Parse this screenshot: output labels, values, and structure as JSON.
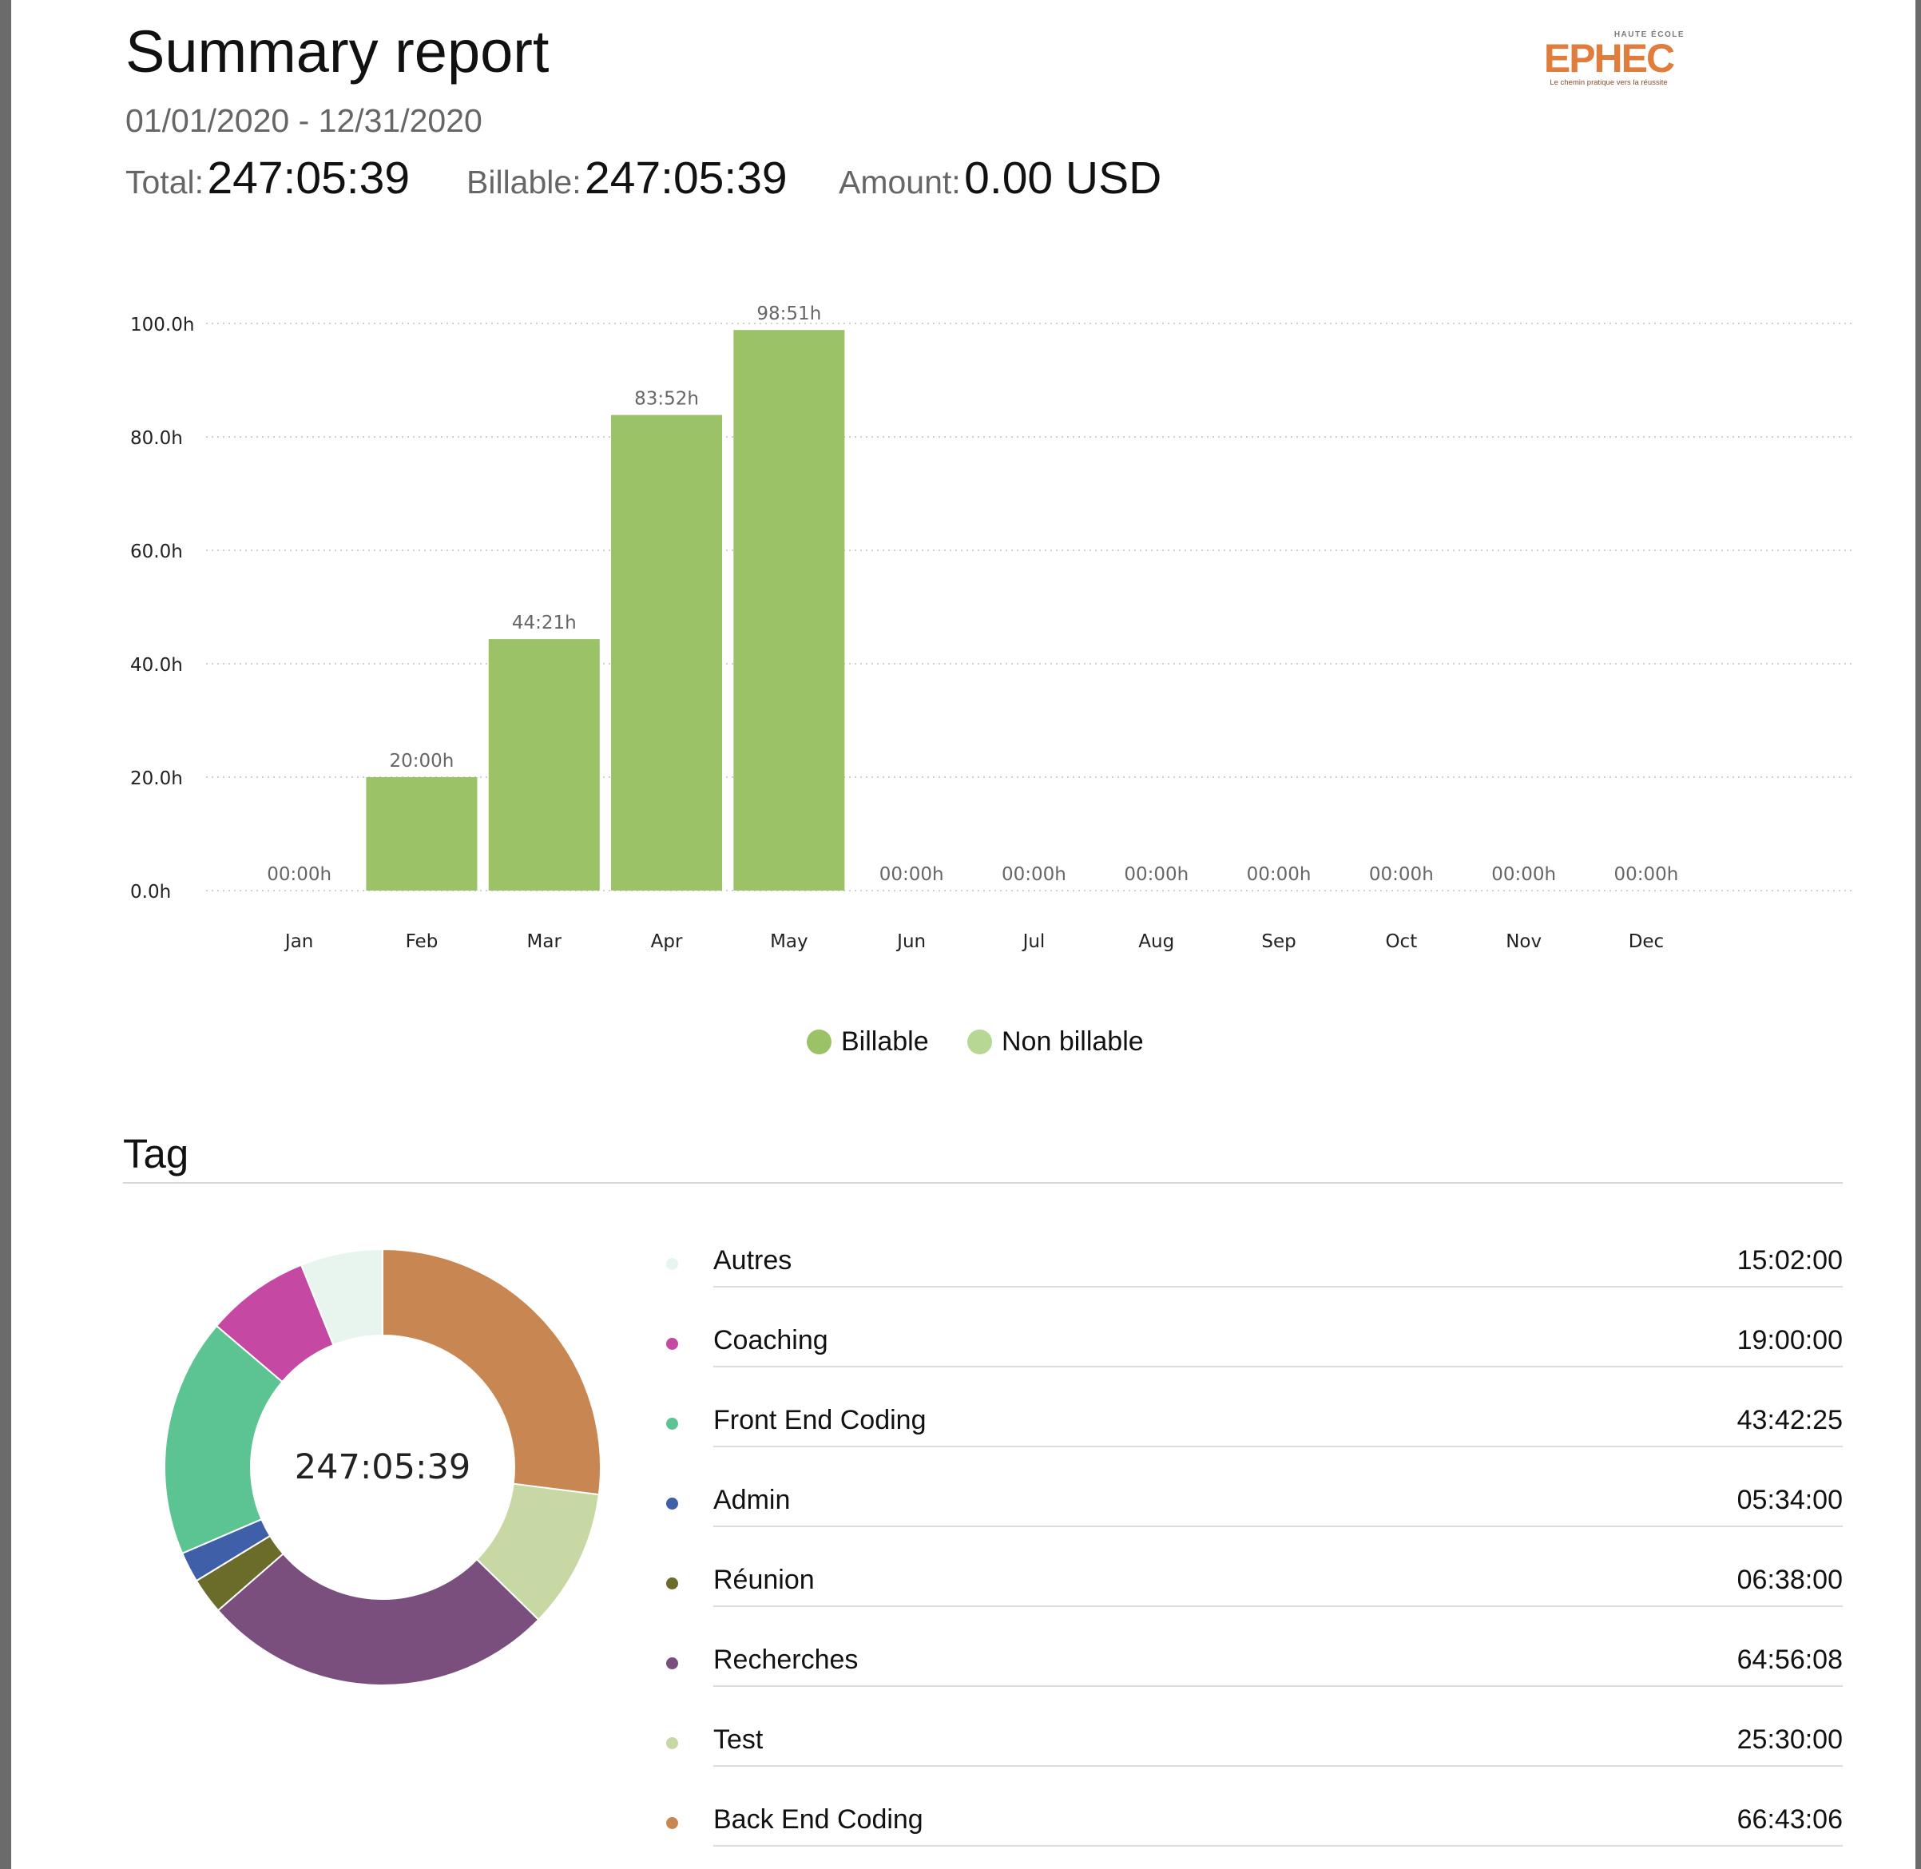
{
  "header": {
    "title": "Summary report",
    "date_range": "01/01/2020 - 12/31/2020",
    "total_label": "Total:",
    "total_value": "247:05:39",
    "billable_label": "Billable:",
    "billable_value": "247:05:39",
    "amount_label": "Amount:",
    "amount_value": "0.00 USD"
  },
  "logo": {
    "top_text": "HAUTE ÉCOLE",
    "name": "EPHEC",
    "tagline": "Le chemin pratique vers la réussite",
    "color": "#e07c3c"
  },
  "chart_data": [
    {
      "type": "bar",
      "categories": [
        "Jan",
        "Feb",
        "Mar",
        "Apr",
        "May",
        "Jun",
        "Jul",
        "Aug",
        "Sep",
        "Oct",
        "Nov",
        "Dec"
      ],
      "series": [
        {
          "name": "Billable",
          "color": "#9bc267",
          "values": [
            0,
            20.0,
            44.35,
            83.87,
            98.85,
            0,
            0,
            0,
            0,
            0,
            0,
            0
          ]
        },
        {
          "name": "Non billable",
          "color": "#b7d894",
          "values": [
            0,
            0,
            0,
            0,
            0,
            0,
            0,
            0,
            0,
            0,
            0,
            0
          ]
        }
      ],
      "data_labels": [
        "00:00h",
        "20:00h",
        "44:21h",
        "83:52h",
        "98:51h",
        "00:00h",
        "00:00h",
        "00:00h",
        "00:00h",
        "00:00h",
        "00:00h",
        "00:00h"
      ],
      "yticks": [
        "0.0h",
        "20.0h",
        "40.0h",
        "60.0h",
        "80.0h",
        "100.0h"
      ],
      "ylim": [
        0,
        100
      ],
      "grid": true,
      "legend_position": "bottom"
    },
    {
      "type": "pie",
      "center_label": "247:05:39",
      "slices": [
        {
          "label": "Back End Coding",
          "value": 66.7183,
          "color": "#c88752"
        },
        {
          "label": "Test",
          "value": 25.5,
          "color": "#c8d8a4"
        },
        {
          "label": "Recherches",
          "value": 64.9356,
          "color": "#7a4f7e"
        },
        {
          "label": "Réunion",
          "value": 6.6333,
          "color": "#6b6b2a"
        },
        {
          "label": "Admin",
          "value": 5.5667,
          "color": "#3f5fa8"
        },
        {
          "label": "Front End Coding",
          "value": 43.7069,
          "color": "#5cc392"
        },
        {
          "label": "Coaching",
          "value": 19.0,
          "color": "#c549a3"
        },
        {
          "label": "Autres",
          "value": 15.0333,
          "color": "#e8f5ef"
        }
      ]
    }
  ],
  "tags": {
    "section_title": "Tag",
    "rows": [
      {
        "name": "Autres",
        "time": "15:02:00",
        "color": "#e8f5ef"
      },
      {
        "name": "Coaching",
        "time": "19:00:00",
        "color": "#c549a3"
      },
      {
        "name": "Front End Coding",
        "time": "43:42:25",
        "color": "#5cc392"
      },
      {
        "name": "Admin",
        "time": "05:34:00",
        "color": "#3f5fa8"
      },
      {
        "name": "Réunion",
        "time": "06:38:00",
        "color": "#6b6b2a"
      },
      {
        "name": "Recherches",
        "time": "64:56:08",
        "color": "#7a4f7e"
      },
      {
        "name": "Test",
        "time": "25:30:00",
        "color": "#c8d8a4"
      },
      {
        "name": "Back End Coding",
        "time": "66:43:06",
        "color": "#c88752"
      }
    ]
  }
}
